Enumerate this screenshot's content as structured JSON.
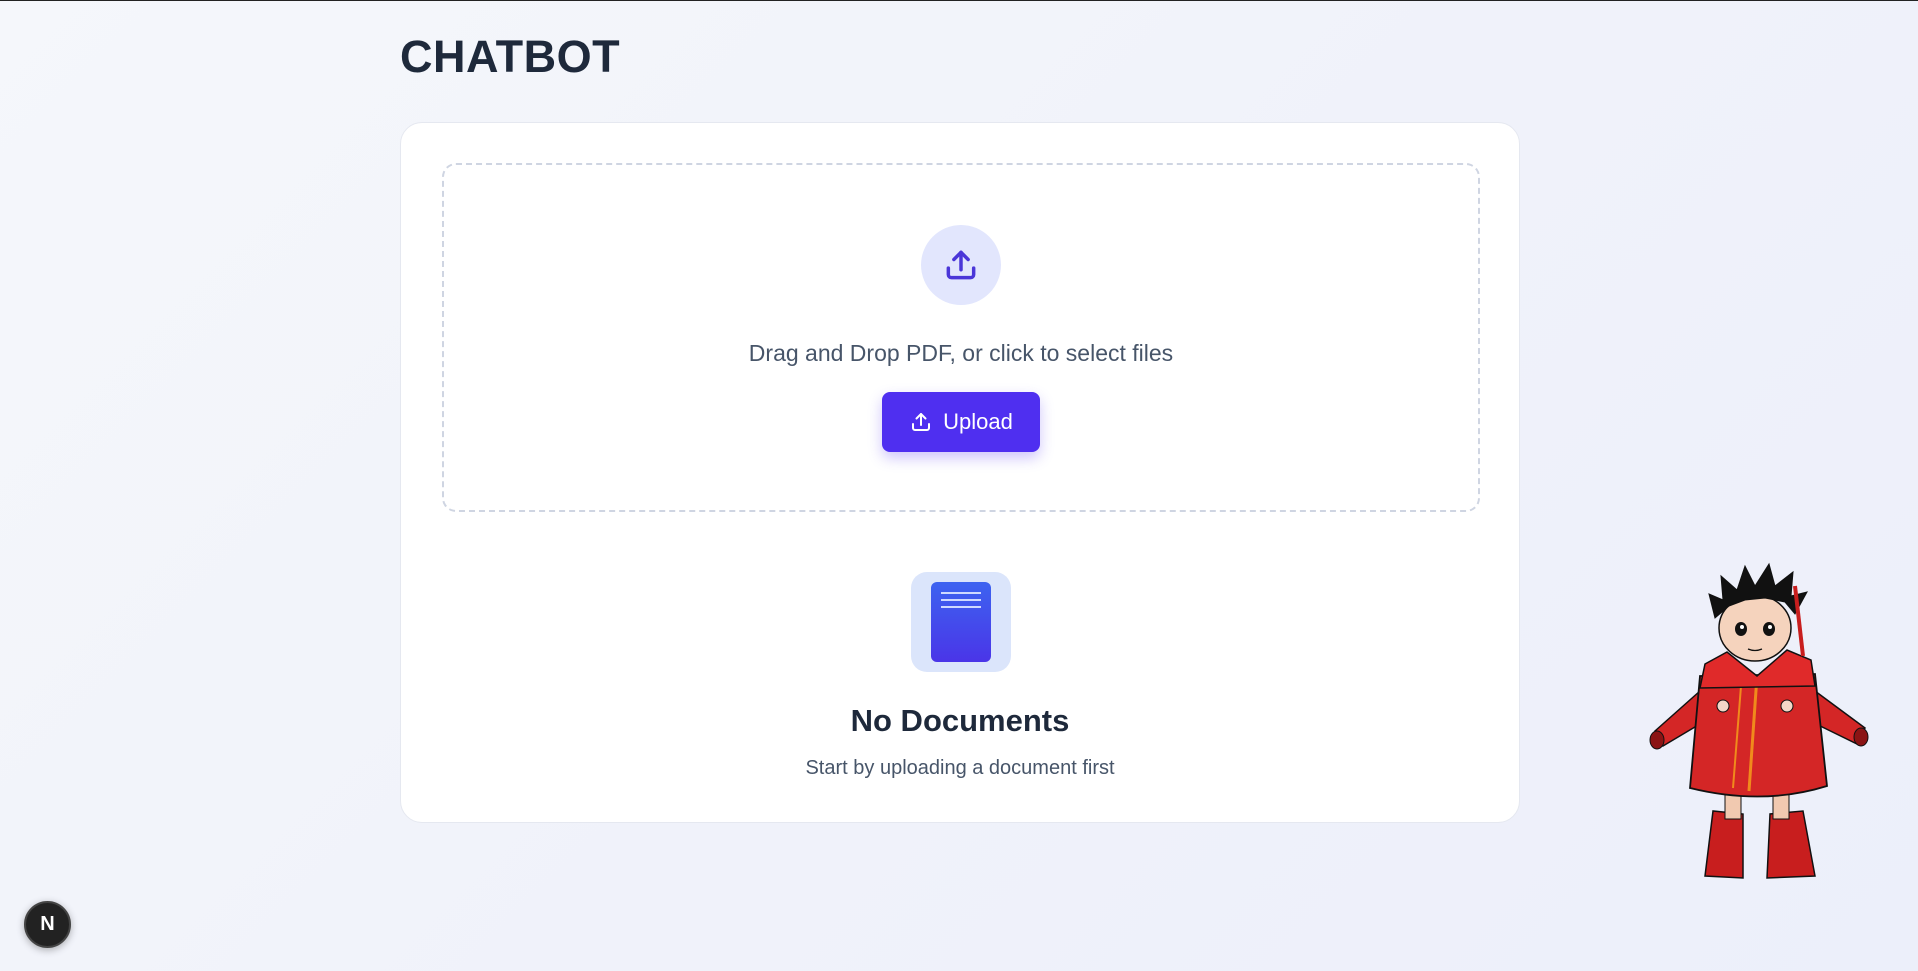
{
  "header": {
    "title": "CHATBOT"
  },
  "upload": {
    "drop_text": "Drag and Drop PDF, or click to select files",
    "button_label": "Upload",
    "icon": "upload-icon",
    "accent_color": "#4f2ff0"
  },
  "empty_state": {
    "icon": "document-icon",
    "title": "No Documents",
    "subtitle": "Start by uploading a document first"
  },
  "dev_badge": {
    "label": "N"
  },
  "mascot": {
    "icon": "character-illustration"
  }
}
